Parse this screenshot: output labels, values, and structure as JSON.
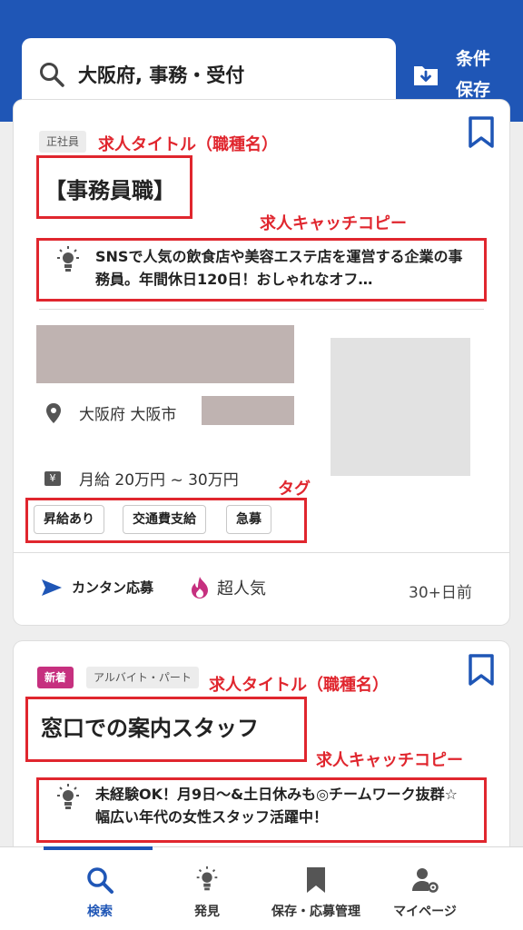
{
  "header": {
    "search_query": "大阪府, 事務・受付",
    "save_conditions_label": "条件\n保存"
  },
  "jobs": [
    {
      "employment_type": "正社員",
      "title": "【事務員職】",
      "catch_copy": "SNSで人気の飲食店や美容エステ店を運営する企業の事務員。年間休日120日！おしゃれなオフ…",
      "location": "大阪府 大阪市",
      "salary": "月給 20万円 ~ 30万円",
      "tags": [
        "昇給あり",
        "交通費支給",
        "急募"
      ],
      "easy_apply_label": "カンタン応募",
      "popular_label": "超人気",
      "posted": "30+日前"
    },
    {
      "new_badge": "新着",
      "employment_type": "アルバイト・パート",
      "title": "窓口での案内スタッフ",
      "catch_copy": "未経験OK！月9日〜&土日休みも◎チームワーク抜群☆幅広い年代の女性スタッフ活躍中！"
    }
  ],
  "annotations": {
    "title_label": "求人タイトル（職種名）",
    "catch_label": "求人キャッチコピー",
    "tag_label": "タグ"
  },
  "bottom_nav": [
    {
      "label": "検索",
      "icon": "search-icon",
      "active": true
    },
    {
      "label": "発見",
      "icon": "lightbulb-icon",
      "active": false
    },
    {
      "label": "保存・応募管理",
      "icon": "bookmark-icon",
      "active": false
    },
    {
      "label": "マイページ",
      "icon": "user-settings-icon",
      "active": false
    }
  ],
  "colors": {
    "brand_blue": "#1f56b6",
    "annotation_red": "#e0262e",
    "new_badge": "#c6307f",
    "popular_flame": "#c6307f"
  }
}
